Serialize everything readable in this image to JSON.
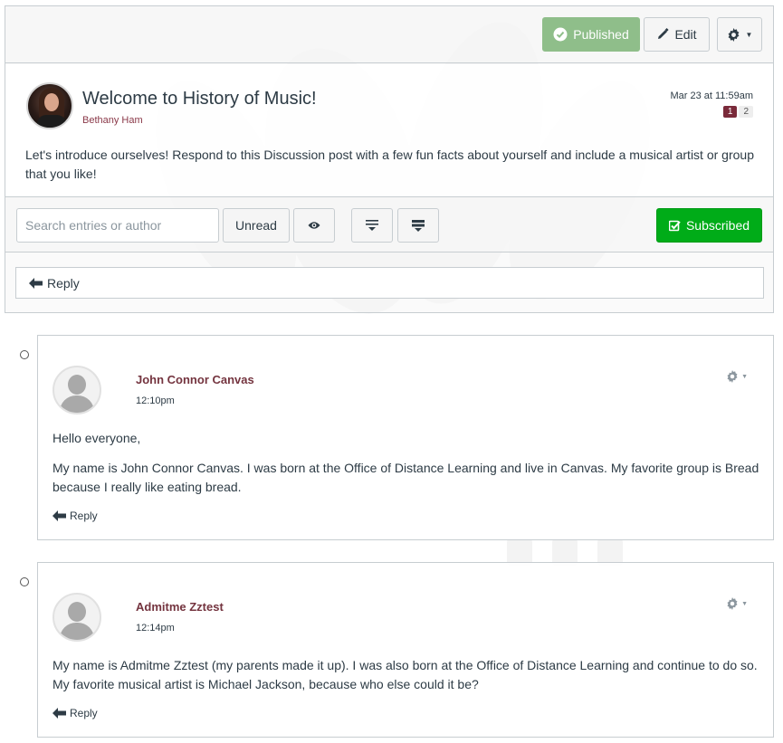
{
  "header": {
    "published_label": "Published",
    "edit_label": "Edit"
  },
  "topic": {
    "title": "Welcome to History of Music!",
    "author": "Bethany Ham",
    "date": "Mar 23 at 11:59am",
    "unread_count": "1",
    "total_count": "2",
    "message": "Let's introduce ourselves! Respond to this Discussion post with a few fun facts about yourself and include a musical artist or group that you like!"
  },
  "toolbar": {
    "search_placeholder": "Search entries or author",
    "unread_label": "Unread",
    "subscribed_label": "Subscribed"
  },
  "reply_label": "Reply",
  "entries": [
    {
      "author": "John Connor Canvas",
      "time": "12:10pm",
      "paragraphs": [
        "Hello everyone,",
        "My name is John Connor Canvas. I was born at the Office of Distance Learning and live in Canvas. My favorite group is Bread because I really like eating bread."
      ],
      "reply_label": "Reply"
    },
    {
      "author": "Admitme Zztest",
      "time": "12:14pm",
      "paragraphs": [
        "My name is Admitme Zztest (my parents made it up). I was also born at the Office of Distance Learning and continue to do so. My favorite musical artist is Michael Jackson, because who else could it be?"
      ],
      "reply_label": "Reply"
    }
  ],
  "colors": {
    "published_bg": "#8fbe8a",
    "subscribed_bg": "#00ac18",
    "author_link": "#74343f",
    "unread_badge": "#7a2a3a"
  },
  "icons": [
    "published-check-icon",
    "pencil-icon",
    "gear-icon",
    "eye-icon",
    "collapse-icon",
    "expand-icon",
    "checkbox-icon",
    "reply-arrow-icon",
    "caret-down-icon"
  ]
}
